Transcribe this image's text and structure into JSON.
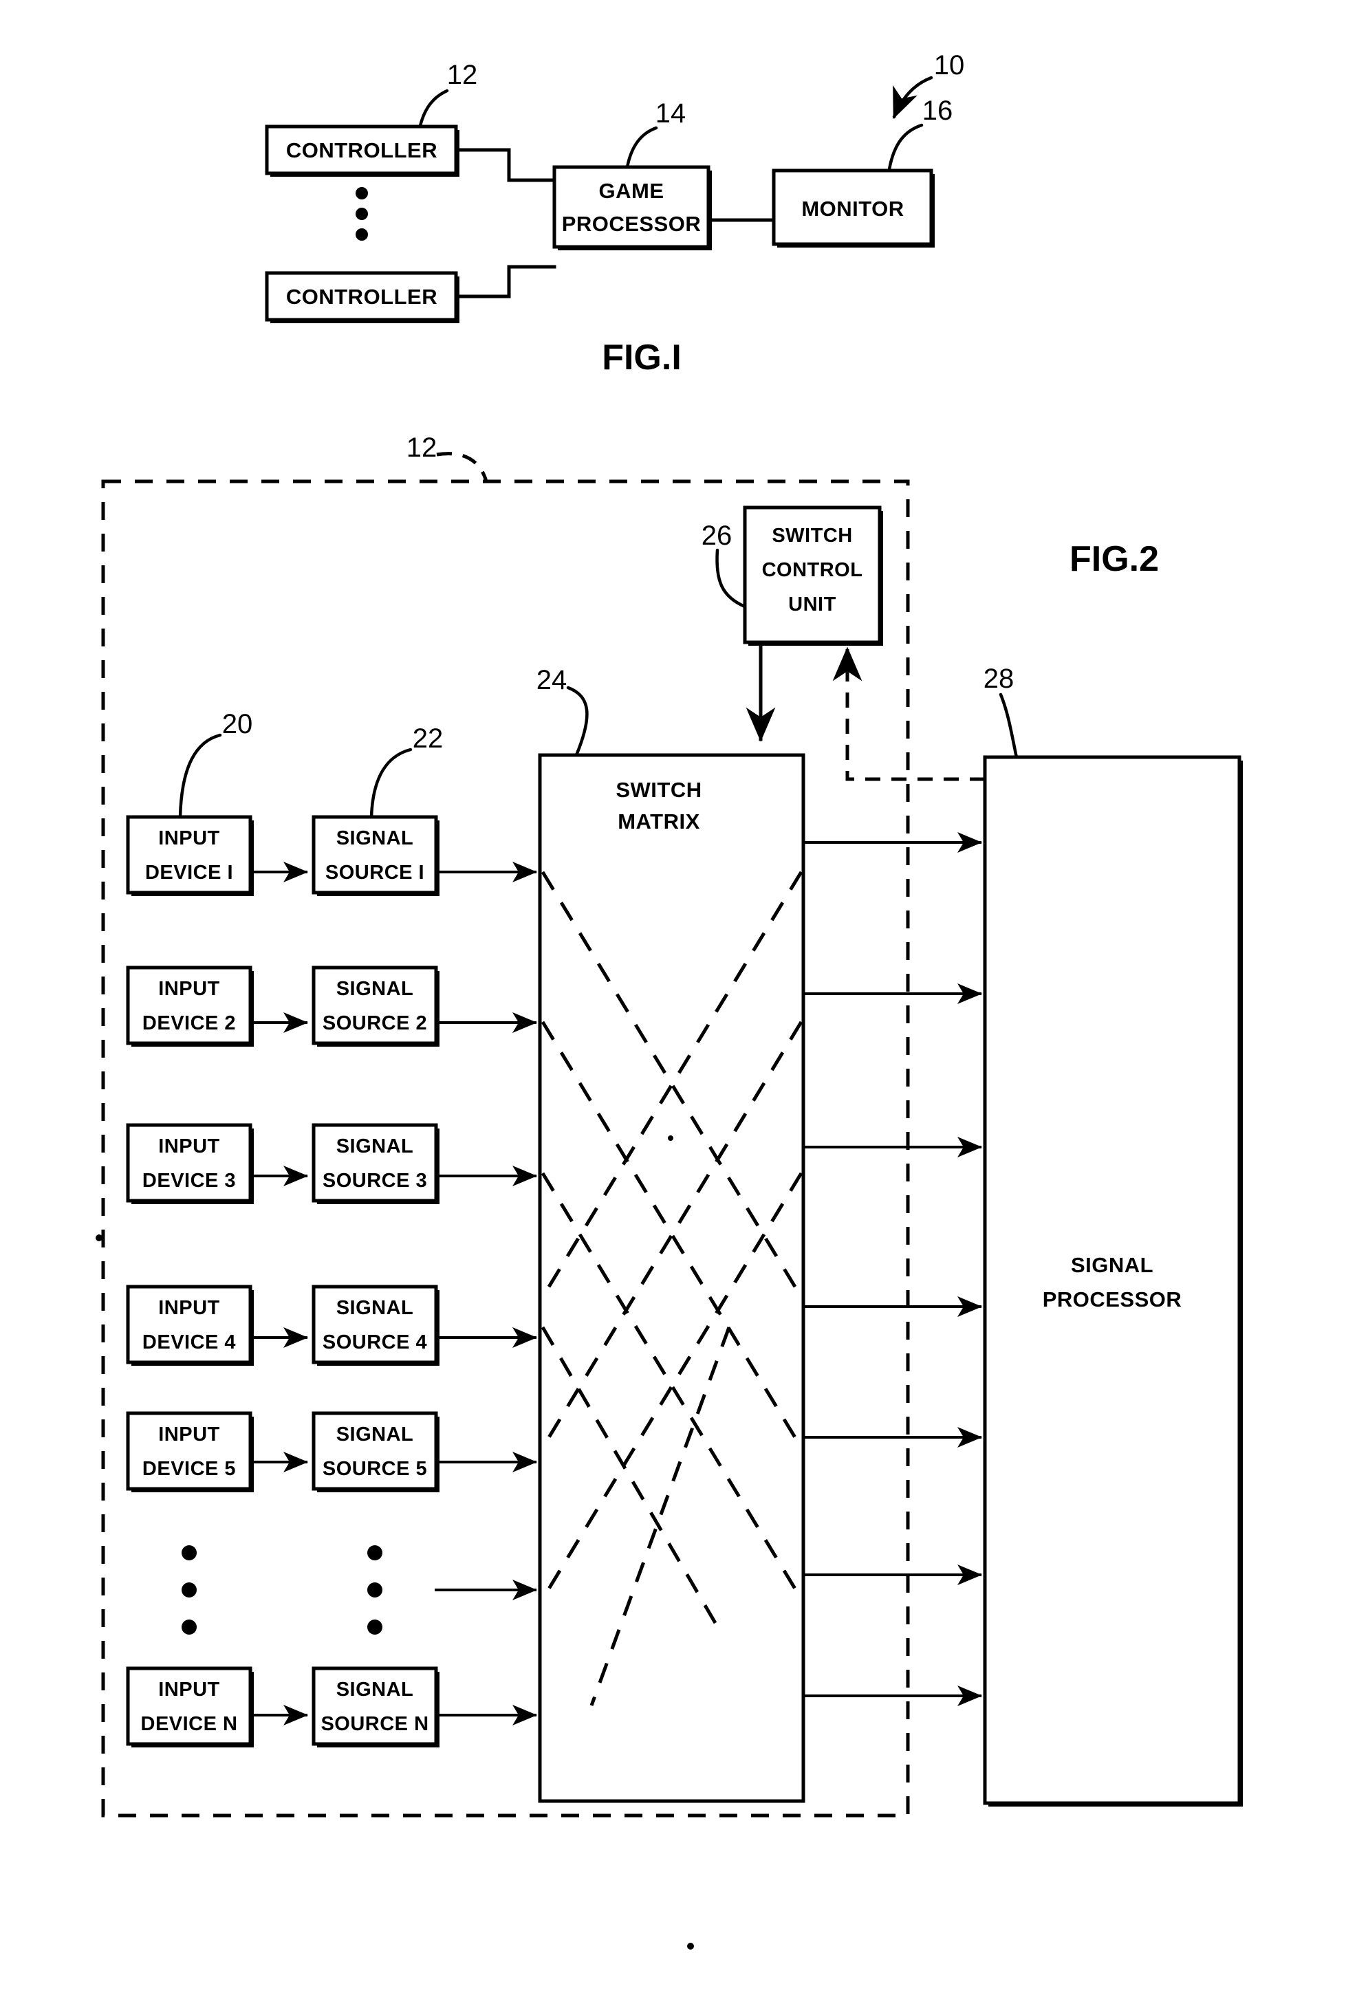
{
  "document": {
    "kind": "patent-drawing-sheet",
    "background_color": "#ffffff",
    "ink_color": "#000000"
  },
  "figures": [
    {
      "id": "fig1",
      "caption": "FIG.I",
      "system_reference": "10",
      "blocks": [
        {
          "ref": "12",
          "lines": [
            "CONTROLLER"
          ]
        },
        {
          "ref": "12",
          "lines": [
            "CONTROLLER"
          ]
        },
        {
          "ref": "14",
          "lines": [
            "GAME",
            "PROCESSOR"
          ]
        },
        {
          "ref": "16",
          "lines": [
            "MONITOR"
          ]
        }
      ]
    },
    {
      "id": "fig2",
      "caption": "FIG.2",
      "enclosure_reference": "12",
      "blocks": [
        {
          "ref": "26",
          "lines": [
            "SWITCH",
            "CONTROL",
            "UNIT"
          ]
        },
        {
          "ref": "24",
          "lines": [
            "SWITCH",
            "MATRIX"
          ]
        },
        {
          "ref": "28",
          "lines": [
            "SIGNAL",
            "PROCESSOR"
          ]
        },
        {
          "ref": "20",
          "lines": [
            "INPUT",
            "DEVICE"
          ]
        },
        {
          "ref": "22",
          "lines": [
            "SIGNAL",
            "SOURCE"
          ]
        }
      ]
    }
  ],
  "fig1": {
    "caption": "FIG.I",
    "ref_system": "10",
    "ref_controller": "12",
    "ref_game_processor": "14",
    "ref_monitor": "16",
    "controller_top": "CONTROLLER",
    "controller_bottom": "CONTROLLER",
    "game_processor_line1": "GAME",
    "game_processor_line2": "PROCESSOR",
    "monitor": "MONITOR"
  },
  "fig2": {
    "caption": "FIG.2",
    "ref_enclosure": "12",
    "ref_switch_control_unit": "26",
    "ref_switch_matrix": "24",
    "ref_signal_processor": "28",
    "ref_input_device": "20",
    "ref_signal_source": "22",
    "switch_control_unit_line1": "SWITCH",
    "switch_control_unit_line2": "CONTROL",
    "switch_control_unit_line3": "UNIT",
    "switch_matrix_line1": "SWITCH",
    "switch_matrix_line2": "MATRIX",
    "signal_processor_line1": "SIGNAL",
    "signal_processor_line2": "PROCESSOR",
    "rows": [
      {
        "input_line1": "INPUT",
        "input_line2": "DEVICE I",
        "source_line1": "SIGNAL",
        "source_line2": "SOURCE I"
      },
      {
        "input_line1": "INPUT",
        "input_line2": "DEVICE 2",
        "source_line1": "SIGNAL",
        "source_line2": "SOURCE 2"
      },
      {
        "input_line1": "INPUT",
        "input_line2": "DEVICE 3",
        "source_line1": "SIGNAL",
        "source_line2": "SOURCE 3"
      },
      {
        "input_line1": "INPUT",
        "input_line2": "DEVICE 4",
        "source_line1": "SIGNAL",
        "source_line2": "SOURCE 4"
      },
      {
        "input_line1": "INPUT",
        "input_line2": "DEVICE 5",
        "source_line1": "SIGNAL",
        "source_line2": "SOURCE 5"
      },
      {
        "input_line1": "INPUT",
        "input_line2": "DEVICE N",
        "source_line1": "SIGNAL",
        "source_line2": "SOURCE N"
      }
    ]
  }
}
